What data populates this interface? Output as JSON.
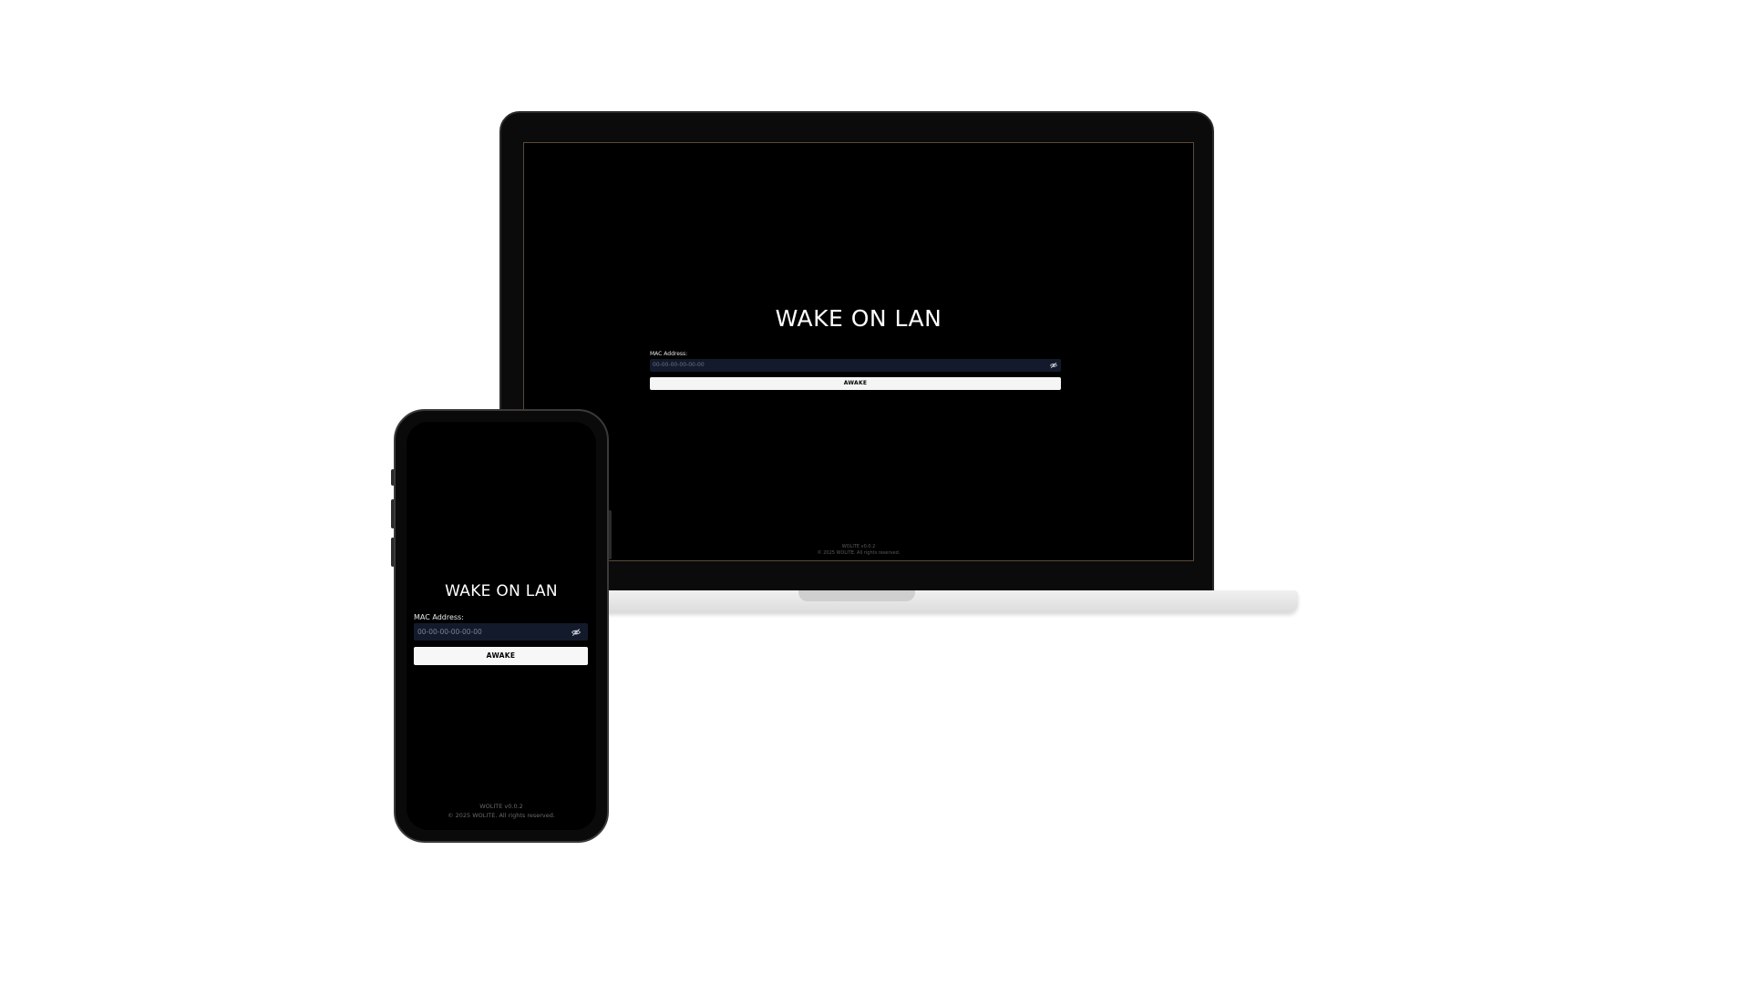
{
  "app": {
    "title": "WAKE ON LAN",
    "mac_label": "MAC Address:",
    "mac_placeholder": "00-00-00-00-00-00",
    "awake_label": "AWAKE",
    "version": "WOLITE v0.0.2",
    "copyright": "© 2025 WOLITE. All rights reserved.",
    "visibility_icon": "eye-off-icon"
  },
  "colors": {
    "background": "#000000",
    "input_background": "#131a2b",
    "button_background": "#f5f5f5",
    "text": "#ffffff",
    "footer_text": "#5a5a5a"
  }
}
